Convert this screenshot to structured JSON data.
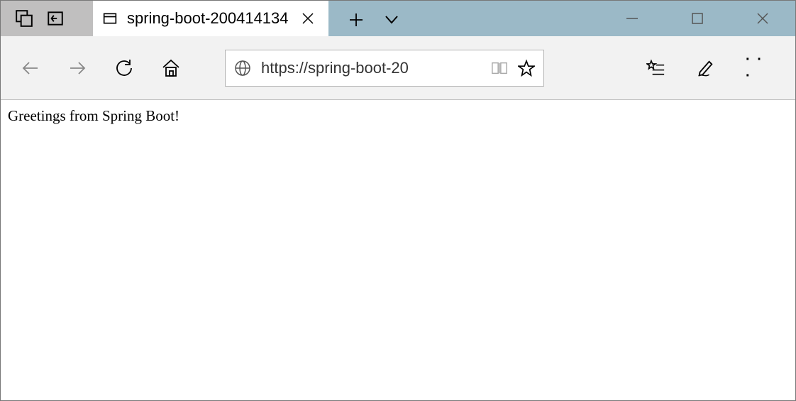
{
  "window": {
    "tab_title": "spring-boot-200414134"
  },
  "addressbar": {
    "url_display": "https://spring-boot-20"
  },
  "page": {
    "body_text": "Greetings from Spring Boot!"
  }
}
